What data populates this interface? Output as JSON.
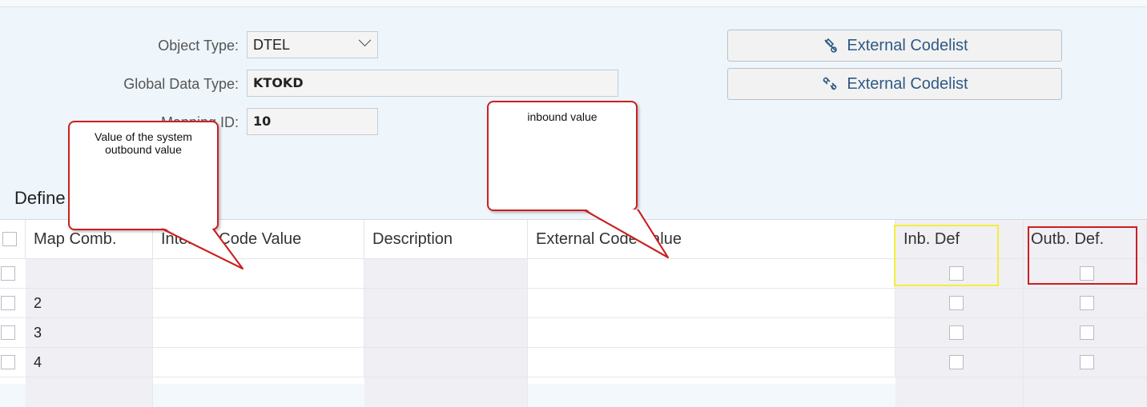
{
  "form": {
    "object_type_label": "Object Type:",
    "object_type_value": "DTEL",
    "global_data_type_label": "Global Data Type:",
    "global_data_type_value": "KTOKD",
    "mapping_id_label": "Mapping ID:",
    "mapping_id_value": "10"
  },
  "buttons": {
    "external_codelist_1": "External Codelist",
    "external_codelist_2": "External Codelist"
  },
  "section": {
    "title": "Define"
  },
  "table": {
    "headers": {
      "map_comb": "Map Comb.",
      "internal_code_value": "Internal Code Value",
      "description": "Description",
      "external_code_value": "External Code Value",
      "inb_def": "Inb. Def",
      "outb_def": "Outb. Def."
    },
    "rows": [
      {
        "map_comb": ""
      },
      {
        "map_comb": "2"
      },
      {
        "map_comb": "3"
      },
      {
        "map_comb": "4"
      }
    ]
  },
  "callouts": {
    "outbound": "Value of the system outbound value",
    "inbound": "inbound value"
  },
  "colors": {
    "callout_border": "#cc1f1f",
    "highlight_yellow": "#f4ee3a",
    "link_text": "#2e5a86"
  }
}
